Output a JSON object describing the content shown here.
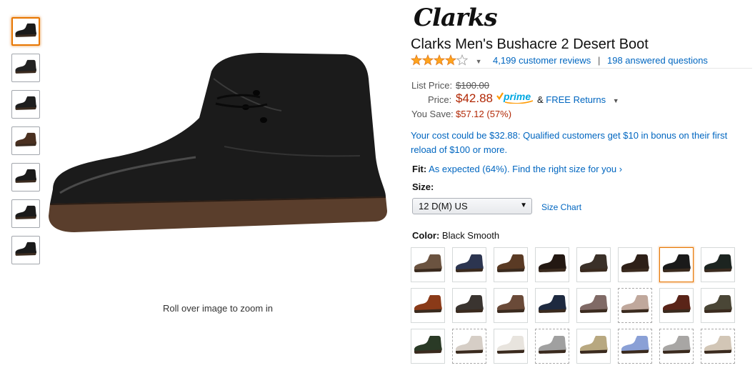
{
  "gallery": {
    "thumbnails": [
      {
        "icon": "boot-side-icon",
        "color": "#1a1a1a"
      },
      {
        "icon": "boot-front-icon",
        "color": "#222222"
      },
      {
        "icon": "boot-back-icon",
        "color": "#1e1e1e"
      },
      {
        "icon": "boot-sole-icon",
        "color": "#4a3020"
      },
      {
        "icon": "boot-side-icon",
        "color": "#1a1a1a"
      },
      {
        "icon": "boot-top-icon",
        "color": "#1a1a1a"
      },
      {
        "icon": "boot-pair-icon",
        "color": "#1a1a1a"
      }
    ],
    "selected_index": 0,
    "zoom_hint": "Roll over image to zoom in"
  },
  "product": {
    "brand": "Clarks",
    "title": "Clarks Men's Bushacre 2 Desert Boot",
    "rating": 4,
    "reviews_link": "4,199 customer reviews",
    "separator": "|",
    "answered_link": "198 answered questions"
  },
  "pricing": {
    "list_price_label": "List Price:",
    "list_price": "$100.00",
    "price_label": "Price:",
    "price": "$42.88",
    "prime_label": "prime",
    "free_returns_prefix": "&",
    "free_returns": "FREE Returns",
    "you_save_label": "You Save:",
    "you_save": "$57.12 (57%)"
  },
  "promo": "Your cost could be $32.88: Qualified customers get $10 in bonus on their first reload of $100 or more.",
  "fit": {
    "label": "Fit:",
    "value": "As expected (64%). Find the right size for you ›"
  },
  "size": {
    "label": "Size:",
    "selected": "12 D(M) US",
    "chart_link": "Size Chart"
  },
  "color": {
    "label": "Color:",
    "selected": "Black Smooth",
    "swatches": [
      {
        "color": "#6b5340",
        "available": true
      },
      {
        "color": "#2c3550",
        "available": true
      },
      {
        "color": "#5a3a24",
        "available": true
      },
      {
        "color": "#231812",
        "available": true
      },
      {
        "color": "#3a3028",
        "available": true
      },
      {
        "color": "#2e2018",
        "available": true
      },
      {
        "color": "#1a1a1a",
        "available": true
      },
      {
        "color": "#1c2420",
        "available": true
      },
      {
        "color": "#8a3a18",
        "available": true
      },
      {
        "color": "#3a3430",
        "available": true
      },
      {
        "color": "#6a4a38",
        "available": true
      },
      {
        "color": "#1e2a40",
        "available": true
      },
      {
        "color": "#806a66",
        "available": true
      },
      {
        "color": "#c0a89c",
        "available": false
      },
      {
        "color": "#5a2418",
        "available": true
      },
      {
        "color": "#4a4636",
        "available": true
      },
      {
        "color": "#2a3a26",
        "available": true
      },
      {
        "color": "#d6cec6",
        "available": false
      },
      {
        "color": "#e8e4de",
        "available": true
      },
      {
        "color": "#a0a0a0",
        "available": false
      },
      {
        "color": "#b8a880",
        "available": true
      },
      {
        "color": "#8aa0d6",
        "available": false
      },
      {
        "color": "#a8a6a4",
        "available": false
      },
      {
        "color": "#d2c6b6",
        "available": false
      }
    ],
    "selected_index": 6
  }
}
